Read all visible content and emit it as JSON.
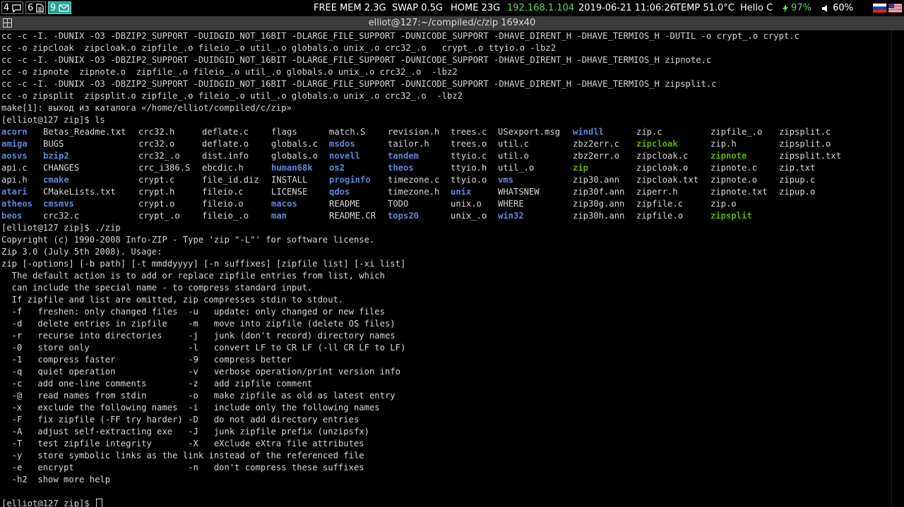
{
  "statusbar": {
    "workspaces": [
      {
        "num": "4",
        "icon": "chat-icon",
        "active": false
      },
      {
        "num": "6",
        "icon": "document-icon",
        "active": false
      },
      {
        "num": "9",
        "icon": "mail-icon",
        "active": true
      }
    ],
    "free_mem": "FREE MEM 2.3G",
    "swap": "SWAP 0.5G",
    "home": "HOME 23G",
    "ip": "192.168.1.104",
    "datetime": "2019-06-21 11:06:26",
    "temp": "TEMP 51.0°C",
    "greeting": "Hello C",
    "battery": "97%",
    "volume": "60%",
    "layouts": [
      "ru-flag-icon",
      "us-flag-icon"
    ],
    "colors": {
      "ip": "#5fd75f",
      "battery": "#5fd75f"
    }
  },
  "window": {
    "title": "elliot@127:~/compiled/c/zip 169x40"
  },
  "terminal": {
    "colors": {
      "fg": "#d6d6d6",
      "dir": "#5f87d7",
      "exe": "#5faf00",
      "bg": "#000000"
    },
    "lines_top": [
      "cc -c -I. -DUNIX -O3 -DBZIP2_SUPPORT -DUIDGID_NOT_16BIT -DLARGE_FILE_SUPPORT -DUNICODE_SUPPORT -DHAVE_DIRENT_H -DHAVE_TERMIOS_H -DUTIL -o crypt_.o crypt.c",
      "cc -o zipcloak  zipcloak.o zipfile_.o fileio_.o util_.o globals.o unix_.o crc32_.o   crypt_.o ttyio.o -lbz2",
      "cc -c -I. -DUNIX -O3 -DBZIP2_SUPPORT -DUIDGID_NOT_16BIT -DLARGE_FILE_SUPPORT -DUNICODE_SUPPORT -DHAVE_DIRENT_H -DHAVE_TERMIOS_H zipnote.c",
      "cc -o zipnote  zipnote.o  zipfile_.o fileio_.o util_.o globals.o unix_.o crc32_.o  -lbz2",
      "cc -c -I. -DUNIX -O3 -DBZIP2_SUPPORT -DUIDGID_NOT_16BIT -DLARGE_FILE_SUPPORT -DUNICODE_SUPPORT -DHAVE_DIRENT_H -DHAVE_TERMIOS_H zipsplit.c",
      "cc -o zipsplit  zipsplit.o zipfile_.o fileio_.o util_.o globals.o unix_.o crc32_.o  -lbz2",
      "make[1]: выход из каталога «/home/elliot/compiled/c/zip»",
      "[elliot@127 zip]$ ls"
    ],
    "ls_columns": [
      [
        {
          "n": "acorn",
          "t": "d"
        },
        {
          "n": "amiga",
          "t": "d"
        },
        {
          "n": "aosvs",
          "t": "d"
        },
        {
          "n": "api.c",
          "t": "f"
        },
        {
          "n": "api.h",
          "t": "f"
        },
        {
          "n": "atari",
          "t": "d"
        },
        {
          "n": "atheos",
          "t": "d"
        },
        {
          "n": "beos",
          "t": "d"
        }
      ],
      [
        {
          "n": "Betas_Readme.txt",
          "t": "f"
        },
        {
          "n": "BUGS",
          "t": "f"
        },
        {
          "n": "bzip2",
          "t": "d"
        },
        {
          "n": "CHANGES",
          "t": "f"
        },
        {
          "n": "cmake",
          "t": "d"
        },
        {
          "n": "CMakeLists.txt",
          "t": "f"
        },
        {
          "n": "cmsmvs",
          "t": "d"
        },
        {
          "n": "crc32.c",
          "t": "f"
        }
      ],
      [
        {
          "n": "crc32.h",
          "t": "f"
        },
        {
          "n": "crc32.o",
          "t": "f"
        },
        {
          "n": "crc32_.o",
          "t": "f"
        },
        {
          "n": "crc_i386.S",
          "t": "f"
        },
        {
          "n": "crypt.c",
          "t": "f"
        },
        {
          "n": "crypt.h",
          "t": "f"
        },
        {
          "n": "crypt.o",
          "t": "f"
        },
        {
          "n": "crypt_.o",
          "t": "f"
        }
      ],
      [
        {
          "n": "deflate.c",
          "t": "f"
        },
        {
          "n": "deflate.o",
          "t": "f"
        },
        {
          "n": "dist.info",
          "t": "f"
        },
        {
          "n": "ebcdic.h",
          "t": "f"
        },
        {
          "n": "file_id.diz",
          "t": "f"
        },
        {
          "n": "fileio.c",
          "t": "f"
        },
        {
          "n": "fileio.o",
          "t": "f"
        },
        {
          "n": "fileio_.o",
          "t": "f"
        }
      ],
      [
        {
          "n": "flags",
          "t": "f"
        },
        {
          "n": "globals.c",
          "t": "f"
        },
        {
          "n": "globals.o",
          "t": "f"
        },
        {
          "n": "human68k",
          "t": "d"
        },
        {
          "n": "INSTALL",
          "t": "f"
        },
        {
          "n": "LICENSE",
          "t": "f"
        },
        {
          "n": "macos",
          "t": "d"
        },
        {
          "n": "man",
          "t": "d"
        }
      ],
      [
        {
          "n": "match.S",
          "t": "f"
        },
        {
          "n": "msdos",
          "t": "d"
        },
        {
          "n": "novell",
          "t": "d"
        },
        {
          "n": "os2",
          "t": "d"
        },
        {
          "n": "proginfo",
          "t": "d"
        },
        {
          "n": "qdos",
          "t": "d"
        },
        {
          "n": "README",
          "t": "f"
        },
        {
          "n": "README.CR",
          "t": "f"
        }
      ],
      [
        {
          "n": "revision.h",
          "t": "f"
        },
        {
          "n": "tailor.h",
          "t": "f"
        },
        {
          "n": "tandem",
          "t": "d"
        },
        {
          "n": "theos",
          "t": "d"
        },
        {
          "n": "timezone.c",
          "t": "f"
        },
        {
          "n": "timezone.h",
          "t": "f"
        },
        {
          "n": "TODO",
          "t": "f"
        },
        {
          "n": "tops20",
          "t": "d"
        }
      ],
      [
        {
          "n": "trees.c",
          "t": "f"
        },
        {
          "n": "trees.o",
          "t": "f"
        },
        {
          "n": "ttyio.c",
          "t": "f"
        },
        {
          "n": "ttyio.h",
          "t": "f"
        },
        {
          "n": "ttyio.o",
          "t": "f"
        },
        {
          "n": "unix",
          "t": "d"
        },
        {
          "n": "unix.o",
          "t": "f"
        },
        {
          "n": "unix_.o",
          "t": "f"
        }
      ],
      [
        {
          "n": "USexport.msg",
          "t": "f"
        },
        {
          "n": "util.c",
          "t": "f"
        },
        {
          "n": "util.o",
          "t": "f"
        },
        {
          "n": "util_.o",
          "t": "f"
        },
        {
          "n": "vms",
          "t": "d"
        },
        {
          "n": "WHATSNEW",
          "t": "f"
        },
        {
          "n": "WHERE",
          "t": "f"
        },
        {
          "n": "win32",
          "t": "d"
        }
      ],
      [
        {
          "n": "windll",
          "t": "d"
        },
        {
          "n": "zbz2err.c",
          "t": "f"
        },
        {
          "n": "zbz2err.o",
          "t": "f"
        },
        {
          "n": "zip",
          "t": "e"
        },
        {
          "n": "zip30.ann",
          "t": "f"
        },
        {
          "n": "zip30f.ann",
          "t": "f"
        },
        {
          "n": "zip30g.ann",
          "t": "f"
        },
        {
          "n": "zip30h.ann",
          "t": "f"
        }
      ],
      [
        {
          "n": "zip.c",
          "t": "f"
        },
        {
          "n": "zipcloak",
          "t": "e"
        },
        {
          "n": "zipcloak.c",
          "t": "f"
        },
        {
          "n": "zipcloak.o",
          "t": "f"
        },
        {
          "n": "zipcloak.txt",
          "t": "f"
        },
        {
          "n": "ziperr.h",
          "t": "f"
        },
        {
          "n": "zipfile.c",
          "t": "f"
        },
        {
          "n": "zipfile.o",
          "t": "f"
        }
      ],
      [
        {
          "n": "zipfile_.o",
          "t": "f"
        },
        {
          "n": "zip.h",
          "t": "f"
        },
        {
          "n": "zipnote",
          "t": "e"
        },
        {
          "n": "zipnote.c",
          "t": "f"
        },
        {
          "n": "zipnote.o",
          "t": "f"
        },
        {
          "n": "zipnote.txt",
          "t": "f"
        },
        {
          "n": "zip.o",
          "t": "f"
        },
        {
          "n": "zipsplit",
          "t": "e"
        }
      ],
      [
        {
          "n": "zipsplit.c",
          "t": "f"
        },
        {
          "n": "zipsplit.o",
          "t": "f"
        },
        {
          "n": "zipsplit.txt",
          "t": "f"
        },
        {
          "n": "zip.txt",
          "t": "f"
        },
        {
          "n": "zipup.c",
          "t": "f"
        },
        {
          "n": "zipup.o",
          "t": "f"
        },
        {
          "n": "",
          "t": "f"
        },
        {
          "n": "",
          "t": "f"
        }
      ]
    ],
    "lines_bottom": [
      "[elliot@127 zip]$ ./zip",
      "Copyright (c) 1990-2008 Info-ZIP - Type 'zip \"-L\"' for software license.",
      "Zip 3.0 (July 5th 2008). Usage:",
      "zip [-options] [-b path] [-t mmddyyyy] [-n suffixes] [zipfile list] [-xi list]",
      "  The default action is to add or replace zipfile entries from list, which",
      "  can include the special name - to compress standard input.",
      "  If zipfile and list are omitted, zip compresses stdin to stdout.",
      "  -f   freshen: only changed files  -u   update: only changed or new files",
      "  -d   delete entries in zipfile    -m   move into zipfile (delete OS files)",
      "  -r   recurse into directories     -j   junk (don't record) directory names",
      "  -0   store only                   -l   convert LF to CR LF (-ll CR LF to LF)",
      "  -1   compress faster              -9   compress better",
      "  -q   quiet operation              -v   verbose operation/print version info",
      "  -c   add one-line comments        -z   add zipfile comment",
      "  -@   read names from stdin        -o   make zipfile as old as latest entry",
      "  -x   exclude the following names  -i   include only the following names",
      "  -F   fix zipfile (-FF try harder) -D   do not add directory entries",
      "  -A   adjust self-extracting exe   -J   junk zipfile prefix (unzipsfx)",
      "  -T   test zipfile integrity       -X   eXclude eXtra file attributes",
      "  -y   store symbolic links as the link instead of the referenced file",
      "  -e   encrypt                      -n   don't compress these suffixes",
      "  -h2  show more help",
      "",
      "[elliot@127 zip]$ "
    ]
  }
}
